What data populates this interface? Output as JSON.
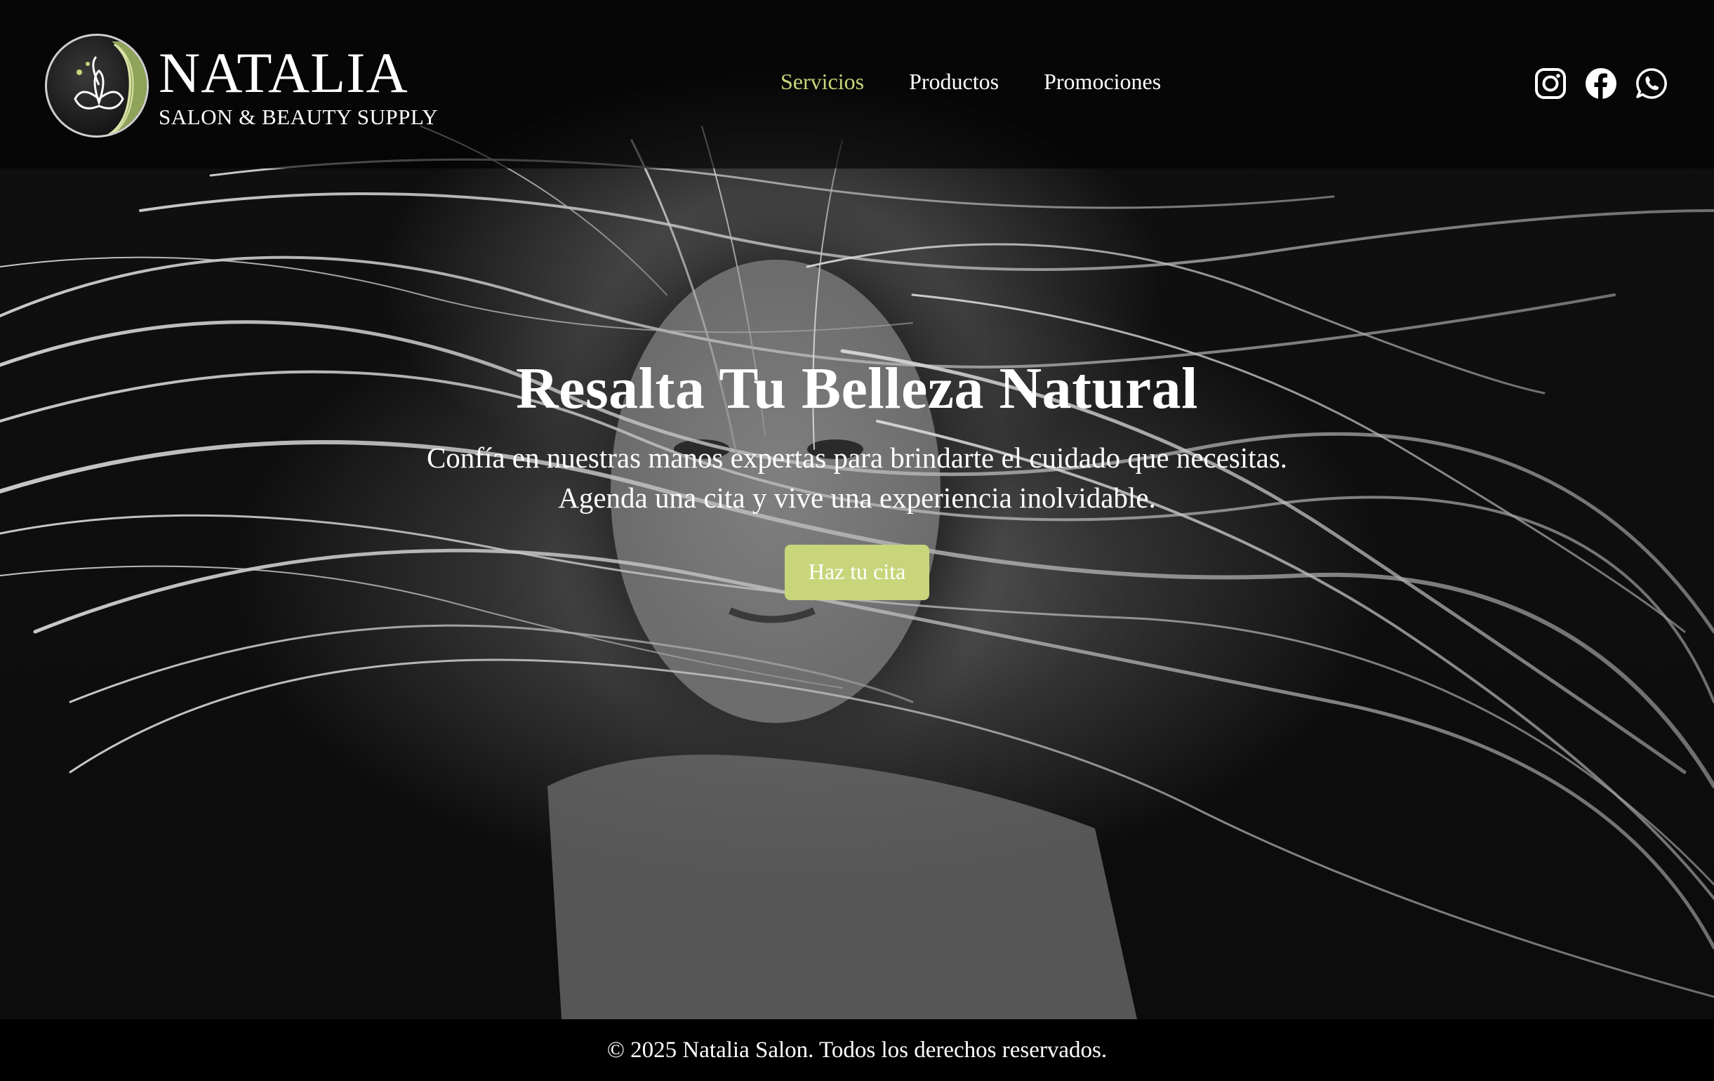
{
  "brand": {
    "name": "NATALIA",
    "tagline": "SALON & BEAUTY SUPPLY"
  },
  "nav": {
    "items": [
      {
        "label": "Servicios",
        "active": true
      },
      {
        "label": "Productos",
        "active": false
      },
      {
        "label": "Promociones",
        "active": false
      }
    ]
  },
  "social": {
    "icons": [
      "instagram-icon",
      "facebook-icon",
      "whatsapp-icon"
    ]
  },
  "hero": {
    "title": "Resalta Tu Belleza Natural",
    "text": "Confía en nuestras manos expertas para brindarte el cuidado que necesitas. Agenda una cita y vive una experiencia inolvidable.",
    "cta_label": "Haz tu cita"
  },
  "footer": {
    "copyright": "© 2025 Natalia Salon. Todos los derechos reservados."
  },
  "colors": {
    "accent": "#c8d57a",
    "background": "#000000",
    "text": "#ffffff"
  }
}
